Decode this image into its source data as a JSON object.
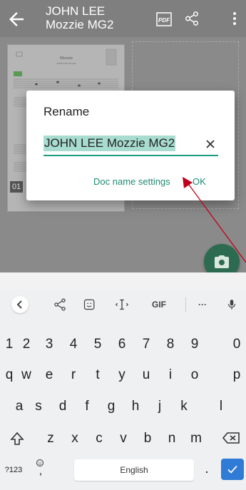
{
  "appbar": {
    "title": "JOHN LEE Mozzie MG2",
    "pdf_label": "PDF"
  },
  "document": {
    "page_number": "01",
    "sheet_title": "Mozzie",
    "sheet_composer": "JOHN LEE Mozzie"
  },
  "dialog": {
    "title": "Rename",
    "field_value": "JOHN LEE Mozzie MG2",
    "doc_name_settings": "Doc name settings",
    "ok": "OK"
  },
  "keyboard": {
    "toolbar": {
      "gif": "GIF",
      "more": "···"
    },
    "row_numbers": [
      "1",
      "2",
      "3",
      "4",
      "5",
      "6",
      "7",
      "8",
      "9",
      "0"
    ],
    "row_1": [
      "q",
      "w",
      "e",
      "r",
      "t",
      "y",
      "u",
      "i",
      "o",
      "p"
    ],
    "row_2": [
      "a",
      "s",
      "d",
      "f",
      "g",
      "h",
      "j",
      "k",
      "l"
    ],
    "row_3": [
      "z",
      "x",
      "c",
      "v",
      "b",
      "n",
      "m"
    ],
    "symbols_key": "?123",
    "comma_key": ",",
    "space_label": "English",
    "period_key": "."
  },
  "colors": {
    "accent": "#1e8a73",
    "fab": "#2d6b51",
    "enter_key": "#2f7bd6",
    "annotation_arrow": "#c0001a"
  }
}
